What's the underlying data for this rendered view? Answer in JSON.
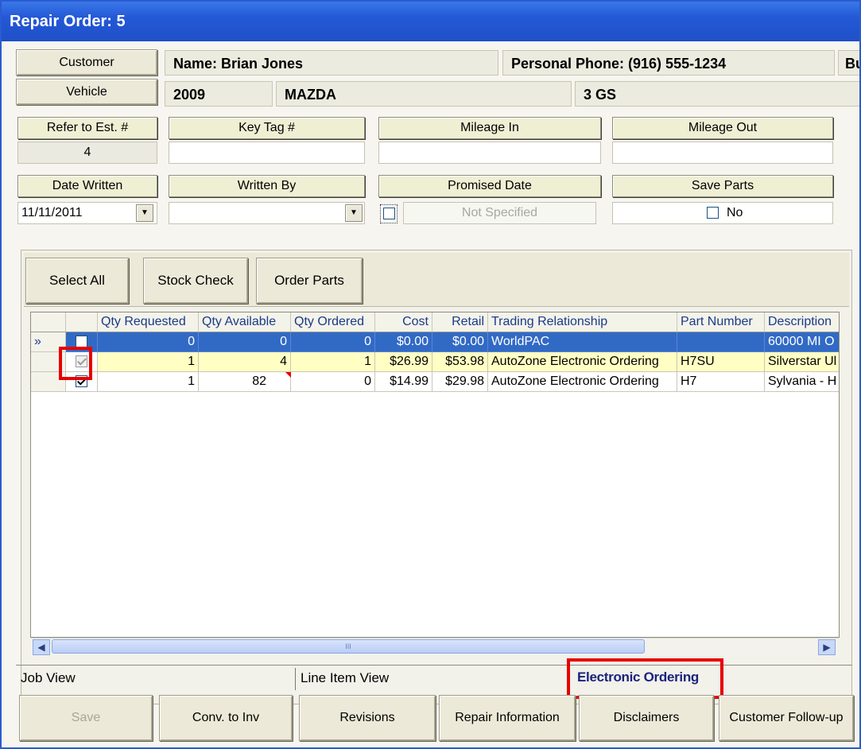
{
  "window": {
    "title": "Repair Order: 5"
  },
  "customer_bar": {
    "customer_button": "Customer",
    "vehicle_button": "Vehicle",
    "name": "Name:  Brian Jones",
    "personal_phone": "Personal Phone: (916) 555-1234",
    "cut_off_label": "Bu",
    "vehicle_year": "2009",
    "vehicle_make": "MAZDA",
    "vehicle_model": "3 GS"
  },
  "fields": {
    "refer_est_label": "Refer to Est. #",
    "refer_est_value": "4",
    "key_tag_label": "Key Tag #",
    "key_tag_value": "",
    "mileage_in_label": "Mileage In",
    "mileage_in_value": "",
    "mileage_out_label": "Mileage Out",
    "mileage_out_value": "",
    "date_written_label": "Date Written",
    "date_written_value": "11/11/2011",
    "written_by_label": "Written By",
    "written_by_value": "",
    "promised_date_label": "Promised Date",
    "promised_date_value": "Not Specified",
    "save_parts_label": "Save Parts",
    "save_parts_value": "No"
  },
  "toolbar": {
    "select_all": "Select All",
    "stock_check": "Stock Check",
    "order_parts": "Order Parts"
  },
  "grid": {
    "columns": [
      "Qty Requested",
      "Qty Available",
      "Qty Ordered",
      "Cost",
      "Retail",
      "Trading Relationship",
      "Part Number",
      "Description"
    ],
    "current_row_marker": "»",
    "rows": [
      {
        "checked": "unchecked",
        "qty_requested": "0",
        "qty_available": "0",
        "qty_ordered": "0",
        "cost": "$0.00",
        "retail": "$0.00",
        "trading_relationship": "WorldPAC",
        "part_number": "",
        "description": "60000 MI O"
      },
      {
        "checked": "checked-disabled",
        "qty_requested": "1",
        "qty_available": "4",
        "qty_ordered": "1",
        "cost": "$26.99",
        "retail": "$53.98",
        "trading_relationship": "AutoZone Electronic Ordering",
        "part_number": "H7SU",
        "description": "Silverstar Ul"
      },
      {
        "checked": "checked",
        "qty_requested": "1",
        "qty_available": "82",
        "qty_ordered": "0",
        "cost": "$14.99",
        "retail": "$29.98",
        "trading_relationship": "AutoZone Electronic Ordering",
        "part_number": "H7",
        "description": "Sylvania - H"
      }
    ]
  },
  "scrollbar": {
    "thumb_grip": "III"
  },
  "tabs": [
    "Job View",
    "Line Item View",
    "Electronic Ordering"
  ],
  "bottom_buttons": [
    "Save",
    "Conv. to Inv",
    "Revisions",
    "Repair Information",
    "Disclaimers",
    "Customer Follow-up"
  ],
  "colors": {
    "selected_row": "#316ac5",
    "highlight_row": "#ffffc4",
    "annotation": "#e80000",
    "active_tab_text": "#1a237e"
  },
  "icons": {
    "dropdown": "chevron-down-icon",
    "scroll_left": "chevron-left-icon",
    "scroll_right": "chevron-right-icon"
  }
}
